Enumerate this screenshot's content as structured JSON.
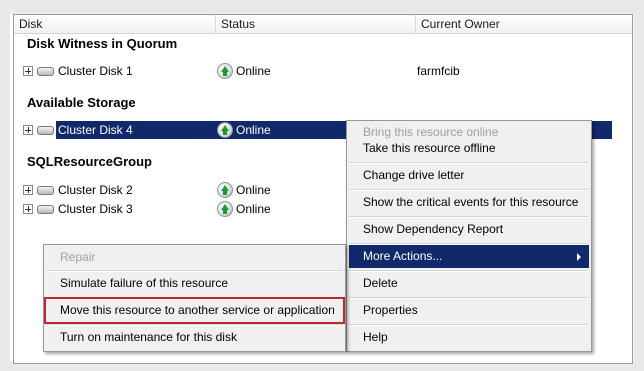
{
  "columns": {
    "disk": "Disk",
    "status": "Status",
    "owner": "Current Owner"
  },
  "groups": [
    {
      "name": "Disk Witness in Quorum"
    },
    {
      "name": "Available Storage"
    },
    {
      "name": "SQLResourceGroup"
    }
  ],
  "rows": [
    {
      "name": "Cluster Disk 1",
      "status": "Online",
      "owner": "farmfcib"
    },
    {
      "name": "Cluster Disk 4",
      "status": "Online",
      "owner": ""
    },
    {
      "name": "Cluster Disk 2",
      "status": "Online",
      "owner": ""
    },
    {
      "name": "Cluster Disk 3",
      "status": "Online",
      "owner": ""
    }
  ],
  "context_menu": {
    "items": [
      "Bring this resource online",
      "Take this resource offline",
      "Change drive letter",
      "Show the critical events for this resource",
      "Show Dependency Report",
      "More Actions...",
      "Delete",
      "Properties",
      "Help"
    ]
  },
  "submenu": {
    "items": [
      "Repair",
      "Simulate failure of this resource",
      "Move this resource to another service or application",
      "Turn on maintenance for this disk"
    ]
  },
  "colors": {
    "selection": "#10296b",
    "highlight_outline": "#c0262e",
    "online_green": "#1f9a2b"
  }
}
